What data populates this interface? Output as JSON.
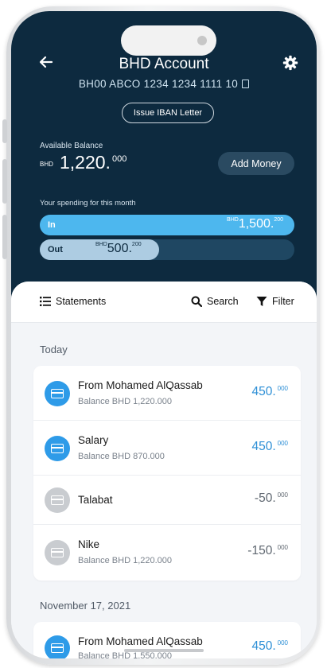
{
  "header": {
    "title": "BHD Account",
    "iban": "BH00 ABCO 1234 1234 1111 10",
    "iban_button": "Issue IBAN Letter"
  },
  "balance": {
    "label": "Available Balance",
    "currency": "BHD",
    "amount": "1,220.",
    "decimals": "000",
    "add_money_label": "Add Money"
  },
  "spending": {
    "label": "Your spending for this month",
    "in": {
      "label": "In",
      "currency": "BHD",
      "amount": "1,500.",
      "decimals": "200",
      "fill_fraction": 1.0
    },
    "out": {
      "label": "Out",
      "currency": "BHD",
      "amount": "500.",
      "decimals": "200",
      "fill_fraction": 0.47
    }
  },
  "toolbar": {
    "statements_label": "Statements",
    "search_label": "Search",
    "filter_label": "Filter"
  },
  "sections": [
    {
      "date": "Today",
      "transactions": [
        {
          "name": "From Mohamed AlQassab",
          "balance": "Balance BHD 1,220.000",
          "amount": "450.",
          "decimals": "000",
          "icon_color": "#2e9be8",
          "amount_color": "#2d8fd6"
        },
        {
          "name": "Salary",
          "balance": "Balance BHD 870.000",
          "amount": "450.",
          "decimals": "000",
          "icon_color": "#2e9be8",
          "amount_color": "#2d8fd6"
        },
        {
          "name": "Talabat",
          "balance": "",
          "amount": "-50.",
          "decimals": "000",
          "icon_color": "#c9ccd0",
          "amount_color": "#5f6770"
        },
        {
          "name": "Nike",
          "balance": "Balance BHD 1,220.000",
          "amount": "-150.",
          "decimals": "000",
          "icon_color": "#c9ccd0",
          "amount_color": "#5f6770"
        }
      ]
    },
    {
      "date": "November 17, 2021",
      "transactions": [
        {
          "name": "From Mohamed AlQassab",
          "balance": "Balance BHD 1.550.000",
          "amount": "450.",
          "decimals": "000",
          "icon_color": "#2e9be8",
          "amount_color": "#2d8fd6"
        }
      ]
    }
  ],
  "icons": [
    "back-arrow-icon",
    "gear-icon",
    "copy-icon",
    "list-icon",
    "search-icon",
    "filter-icon",
    "card-icon"
  ]
}
